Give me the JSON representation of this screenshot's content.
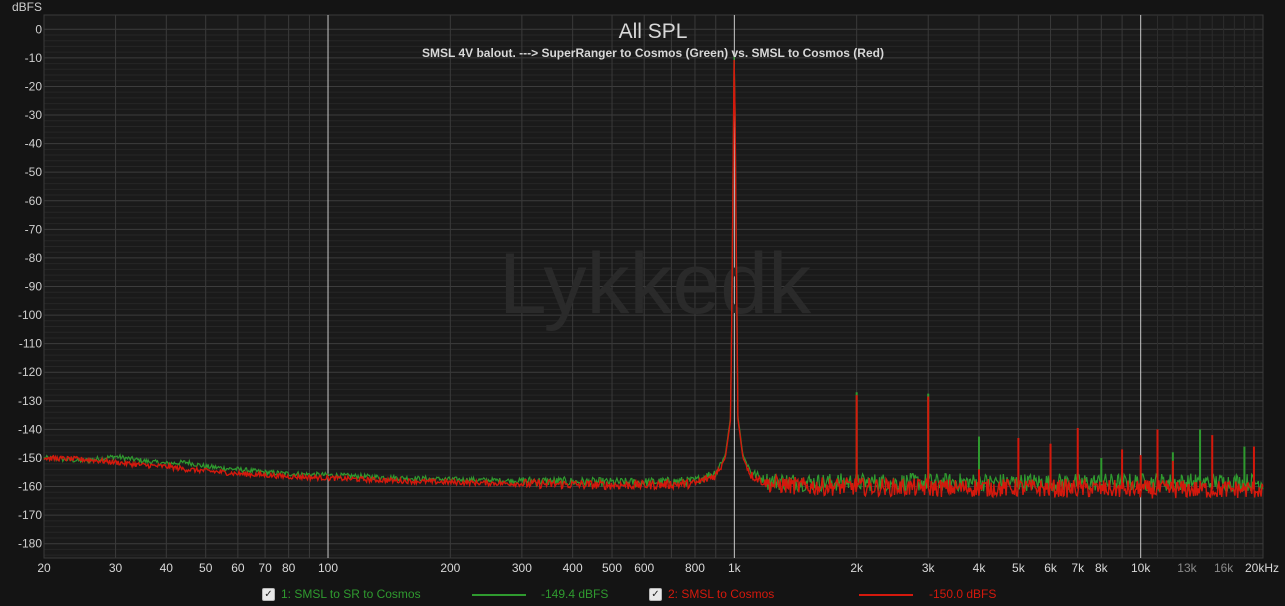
{
  "chart_data": {
    "type": "line",
    "title": "All SPL",
    "subtitle": "SMSL 4V balout. ---> SuperRanger to Cosmos (Green) vs. SMSL to Cosmos (Red)",
    "ylabel": "dBFS",
    "xlabel": "",
    "x_scale": "log",
    "xlim": [
      20,
      20000
    ],
    "ylim": [
      -185,
      5
    ],
    "grid": true,
    "watermark": "Lykkedk",
    "y_ticks": [
      {
        "v": 0,
        "label": "0"
      },
      {
        "v": -10,
        "label": "-10"
      },
      {
        "v": -20,
        "label": "-20"
      },
      {
        "v": -30,
        "label": "-30"
      },
      {
        "v": -40,
        "label": "-40"
      },
      {
        "v": -50,
        "label": "-50"
      },
      {
        "v": -60,
        "label": "-60"
      },
      {
        "v": -70,
        "label": "-70"
      },
      {
        "v": -80,
        "label": "-80"
      },
      {
        "v": -90,
        "label": "-90"
      },
      {
        "v": -100,
        "label": "-100"
      },
      {
        "v": -110,
        "label": "-110"
      },
      {
        "v": -120,
        "label": "-120"
      },
      {
        "v": -130,
        "label": "-130"
      },
      {
        "v": -140,
        "label": "-140"
      },
      {
        "v": -150,
        "label": "-150"
      },
      {
        "v": -160,
        "label": "-160"
      },
      {
        "v": -170,
        "label": "-170"
      },
      {
        "v": -180,
        "label": "-180"
      }
    ],
    "x_ticks": [
      {
        "v": 20,
        "label": "20"
      },
      {
        "v": 30,
        "label": "30"
      },
      {
        "v": 40,
        "label": "40"
      },
      {
        "v": 50,
        "label": "50"
      },
      {
        "v": 60,
        "label": "60"
      },
      {
        "v": 70,
        "label": "70"
      },
      {
        "v": 80,
        "label": "80"
      },
      {
        "v": 100,
        "label": "100"
      },
      {
        "v": 200,
        "label": "200"
      },
      {
        "v": 300,
        "label": "300"
      },
      {
        "v": 400,
        "label": "400"
      },
      {
        "v": 500,
        "label": "500"
      },
      {
        "v": 600,
        "label": "600"
      },
      {
        "v": 800,
        "label": "800"
      },
      {
        "v": 1000,
        "label": "1k"
      },
      {
        "v": 2000,
        "label": "2k"
      },
      {
        "v": 3000,
        "label": "3k"
      },
      {
        "v": 4000,
        "label": "4k"
      },
      {
        "v": 5000,
        "label": "5k"
      },
      {
        "v": 6000,
        "label": "6k"
      },
      {
        "v": 7000,
        "label": "7k"
      },
      {
        "v": 8000,
        "label": "8k"
      },
      {
        "v": 10000,
        "label": "10k"
      },
      {
        "v": 13000,
        "label": "13k"
      },
      {
        "v": 16000,
        "label": "16k"
      },
      {
        "v": 20000,
        "label": "20kHz"
      }
    ],
    "series": [
      {
        "name": "1: SMSL to SR to Cosmos",
        "color": "#2f9a2f",
        "legend_value": "-149.4 dBFS",
        "points": [
          [
            20,
            -150
          ],
          [
            25,
            -151
          ],
          [
            30,
            -149.5
          ],
          [
            35,
            -151
          ],
          [
            40,
            -152
          ],
          [
            45,
            -151.5
          ],
          [
            50,
            -153
          ],
          [
            60,
            -154
          ],
          [
            70,
            -155
          ],
          [
            80,
            -155.5
          ],
          [
            100,
            -156
          ],
          [
            150,
            -157
          ],
          [
            200,
            -157.5
          ],
          [
            300,
            -158
          ],
          [
            400,
            -158.3
          ],
          [
            500,
            -158.5
          ],
          [
            600,
            -158.5
          ],
          [
            800,
            -158
          ],
          [
            900,
            -155
          ],
          [
            950,
            -149
          ],
          [
            980,
            -135
          ],
          [
            1000,
            -1
          ],
          [
            1020,
            -135
          ],
          [
            1050,
            -149
          ],
          [
            1100,
            -155
          ],
          [
            1200,
            -158
          ],
          [
            1500,
            -158.5
          ],
          [
            2000,
            -158.5
          ],
          [
            3000,
            -158.5
          ],
          [
            5000,
            -158.5
          ],
          [
            10000,
            -158.5
          ],
          [
            15000,
            -158.5
          ],
          [
            20000,
            -158.5
          ]
        ],
        "spikes": [
          [
            2000,
            -127
          ],
          [
            3000,
            -127.5
          ],
          [
            4000,
            -142.5
          ],
          [
            6000,
            -156
          ],
          [
            8000,
            -150
          ],
          [
            9000,
            -155
          ],
          [
            12000,
            -148
          ],
          [
            14000,
            -140
          ],
          [
            18000,
            -146
          ]
        ]
      },
      {
        "name": "2: SMSL to Cosmos",
        "color": "#d4190d",
        "legend_value": "-150.0 dBFS",
        "points": [
          [
            20,
            -150
          ],
          [
            25,
            -150.5
          ],
          [
            30,
            -151.5
          ],
          [
            35,
            -152.5
          ],
          [
            40,
            -153
          ],
          [
            45,
            -154
          ],
          [
            50,
            -154.5
          ],
          [
            60,
            -155.5
          ],
          [
            70,
            -156
          ],
          [
            80,
            -156.5
          ],
          [
            100,
            -157
          ],
          [
            150,
            -158
          ],
          [
            200,
            -158.5
          ],
          [
            300,
            -159
          ],
          [
            400,
            -159.3
          ],
          [
            500,
            -159.5
          ],
          [
            600,
            -159.5
          ],
          [
            800,
            -159
          ],
          [
            900,
            -156
          ],
          [
            950,
            -150
          ],
          [
            980,
            -136
          ],
          [
            1000,
            -3
          ],
          [
            1020,
            -136
          ],
          [
            1050,
            -150
          ],
          [
            1100,
            -156
          ],
          [
            1200,
            -159
          ],
          [
            1500,
            -160
          ],
          [
            2000,
            -160
          ],
          [
            3000,
            -160.5
          ],
          [
            5000,
            -160.5
          ],
          [
            10000,
            -161
          ],
          [
            15000,
            -161
          ],
          [
            20000,
            -161
          ]
        ],
        "spikes": [
          [
            2000,
            -128
          ],
          [
            3000,
            -128.5
          ],
          [
            4000,
            -154
          ],
          [
            5000,
            -143
          ],
          [
            6000,
            -145
          ],
          [
            7000,
            -139.5
          ],
          [
            9000,
            -147
          ],
          [
            10000,
            -149
          ],
          [
            11000,
            -140
          ],
          [
            12000,
            -151
          ],
          [
            15000,
            -142
          ],
          [
            19000,
            -146
          ]
        ]
      }
    ]
  },
  "legend": {
    "items": [
      {
        "checked": "✓",
        "label": "1: SMSL to SR to Cosmos",
        "value": "-149.4 dBFS",
        "color": "#2f9a2f"
      },
      {
        "checked": "✓",
        "label": "2: SMSL to Cosmos",
        "value": "-150.0 dBFS",
        "color": "#d4190d"
      }
    ]
  }
}
